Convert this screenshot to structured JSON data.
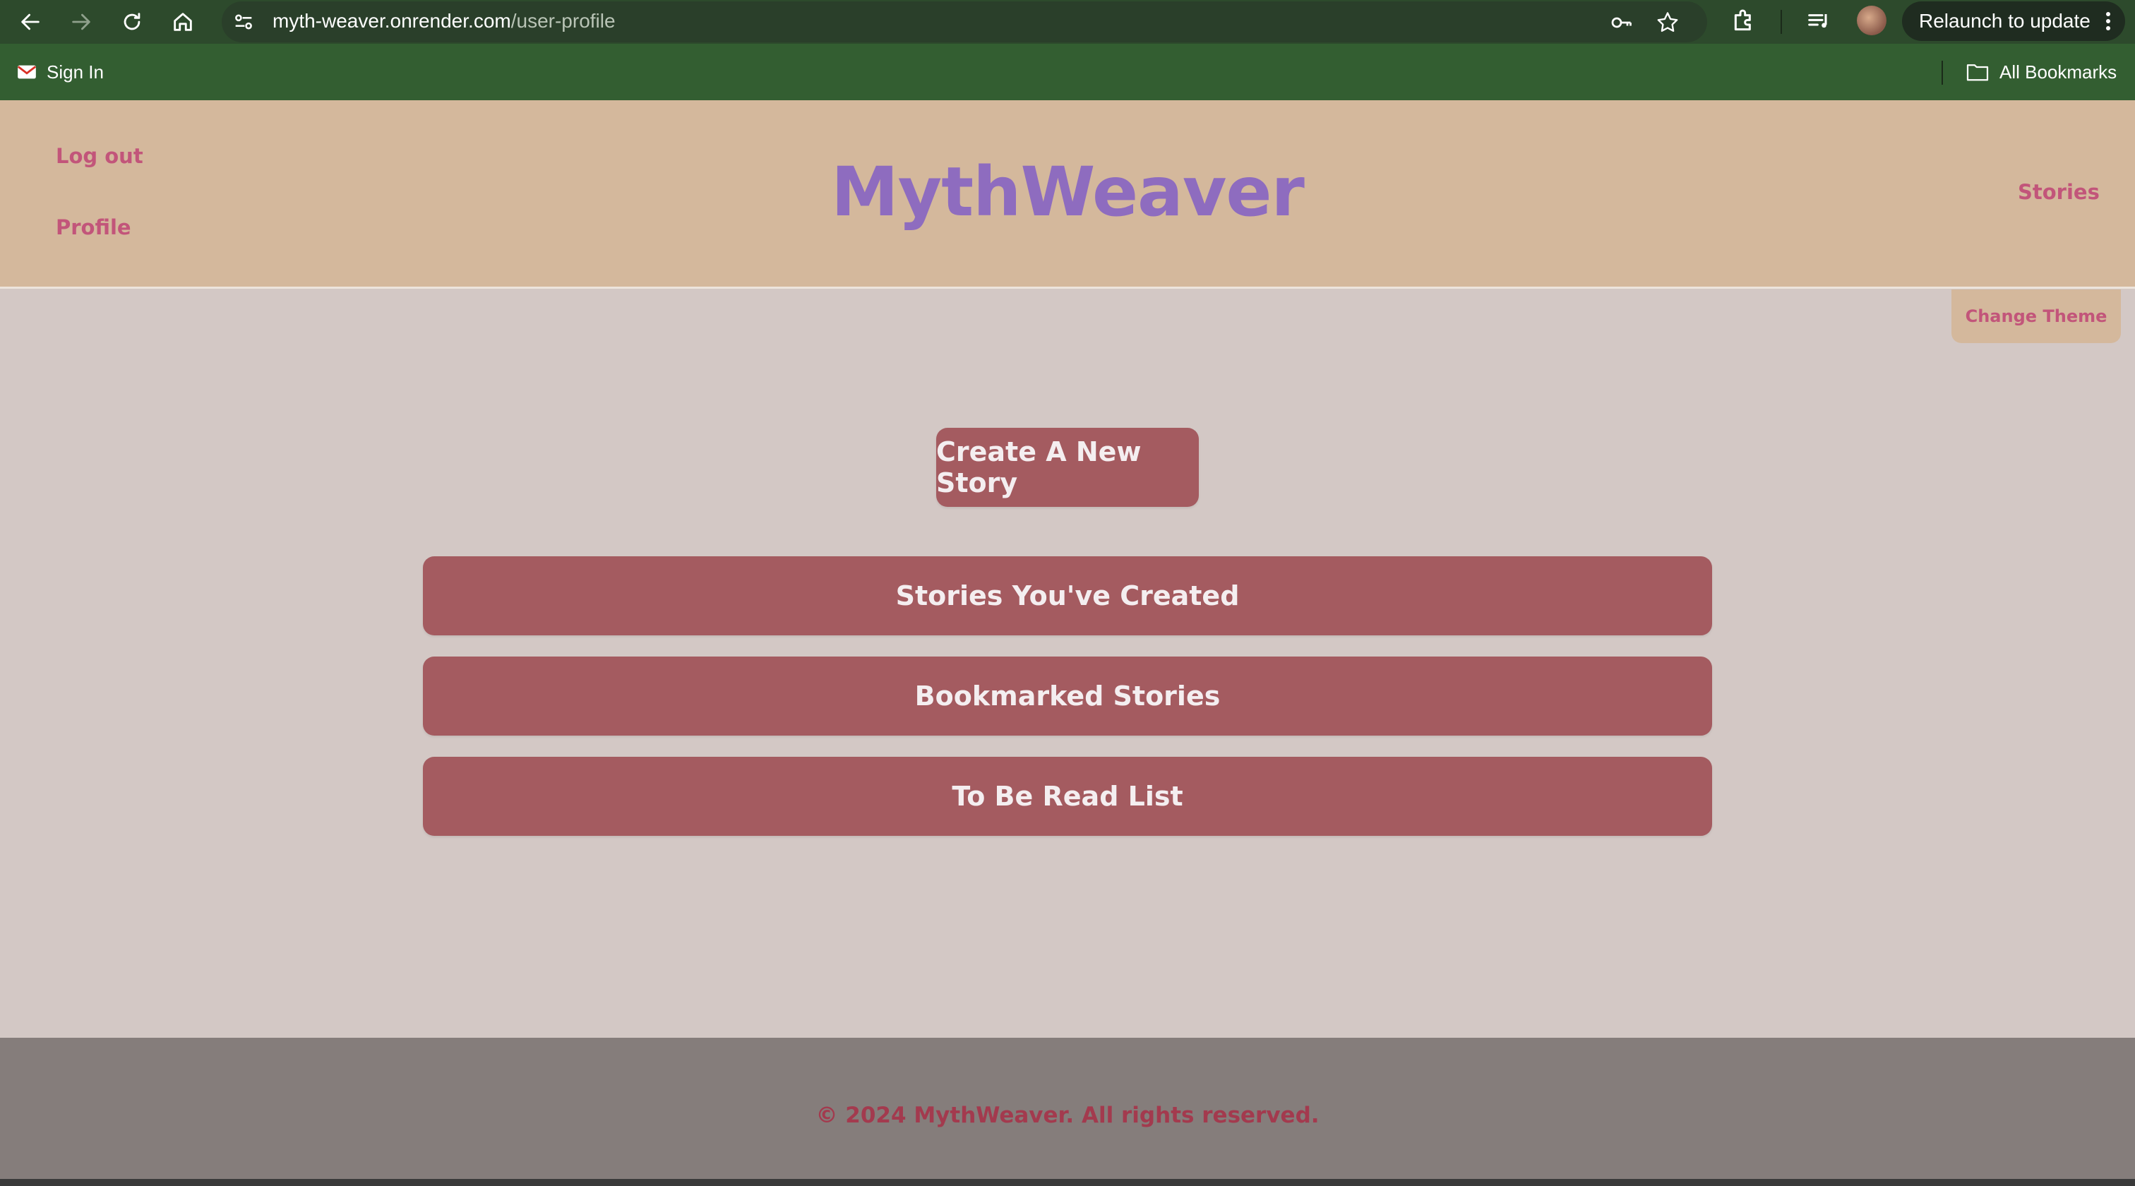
{
  "browser": {
    "url_domain": "myth-weaver.onrender.com",
    "url_path": "/user-profile",
    "relaunch_label": "Relaunch to update",
    "bookmarks": {
      "sign_in": "Sign In",
      "all_bookmarks": "All Bookmarks"
    }
  },
  "header": {
    "logout": "Log out",
    "profile": "Profile",
    "logo": "MythWeaver",
    "stories": "Stories",
    "change_theme": "Change Theme"
  },
  "main": {
    "create_story": "Create A New Story",
    "stories_created": "Stories You've Created",
    "bookmarked": "Bookmarked Stories",
    "tbr": "To Be Read List"
  },
  "footer": {
    "text": "© 2024 MythWeaver. All rights reserved."
  },
  "colors": {
    "header_bg": "#d4b89c",
    "page_bg": "#d3c8c5",
    "button_bg": "#a45b60",
    "link": "#c2557a",
    "logo": "#8e6cbf",
    "footer_bg": "#857d7b"
  }
}
